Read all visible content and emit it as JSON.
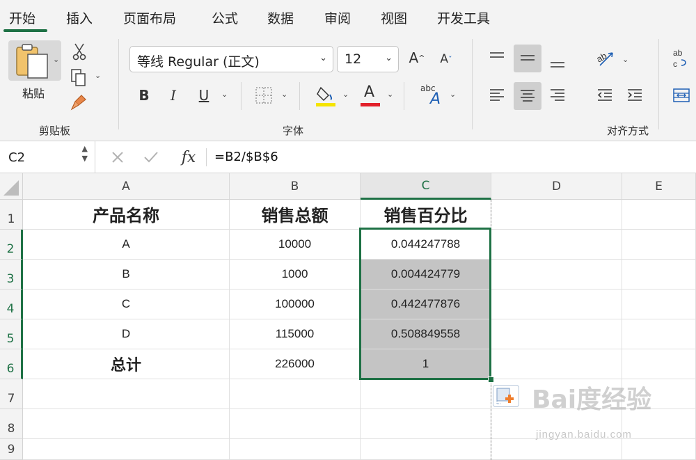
{
  "tabs": [
    "开始",
    "插入",
    "页面布局",
    "公式",
    "数据",
    "审阅",
    "视图",
    "开发工具"
  ],
  "ribbon": {
    "clipboard": {
      "label": "剪贴板",
      "paste_label": "粘贴"
    },
    "font": {
      "label": "字体",
      "font_name": "等线 Regular (正文)",
      "font_size": "12",
      "bold_label": "B",
      "italic_label": "I",
      "underline_label": "U",
      "font_color_label": "A",
      "abc_label": "abc",
      "grow_label": "A",
      "shrink_label": "A",
      "highlight_color": "#f5e400",
      "font_color": "#e2202a"
    },
    "alignment": {
      "label": "对齐方式"
    }
  },
  "formula_bar": {
    "name_box": "C2",
    "fx_label": "fx",
    "formula": "=B2/$B$6"
  },
  "sheet": {
    "columns": [
      "A",
      "B",
      "C",
      "D",
      "E"
    ],
    "rows": [
      "1",
      "2",
      "3",
      "4",
      "5",
      "6",
      "7",
      "8",
      "9"
    ],
    "header_row": [
      "产品名称",
      "销售总额",
      "销售百分比"
    ],
    "data_rows": [
      [
        "A",
        "10000",
        "0.044247788"
      ],
      [
        "B",
        "1000",
        "0.004424779"
      ],
      [
        "C",
        "100000",
        "0.442477876"
      ],
      [
        "D",
        "115000",
        "0.508849558"
      ],
      [
        "总计",
        "226000",
        "1"
      ]
    ],
    "selection_color": "#1e7145"
  },
  "watermark": {
    "text": "Bai度经验",
    "sub": "jingyan.baidu.com"
  }
}
